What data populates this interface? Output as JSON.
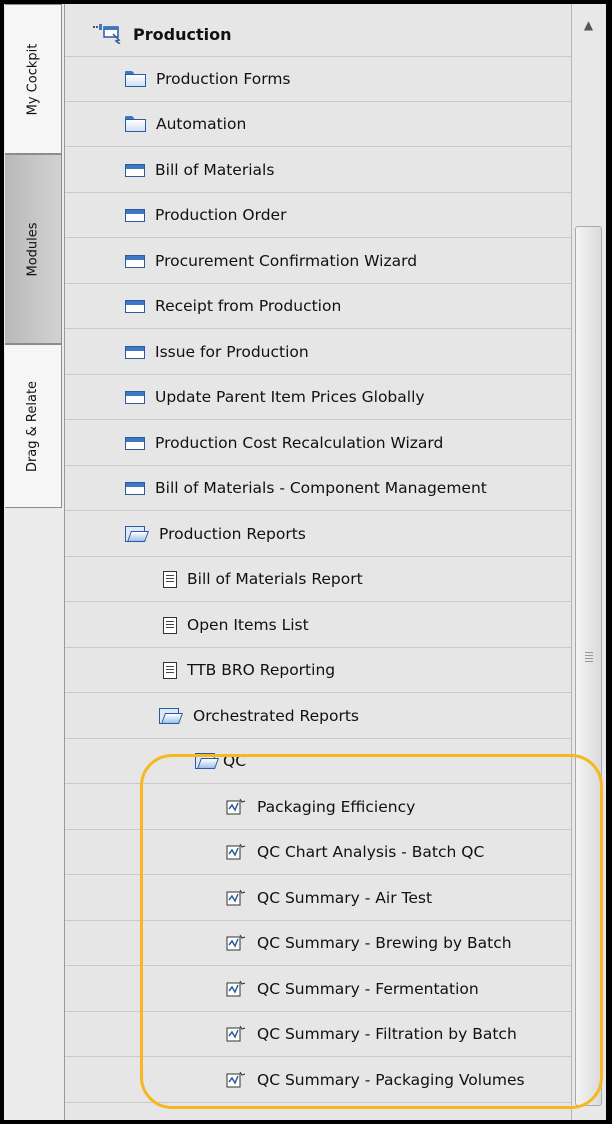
{
  "tabs": [
    {
      "label": "My Cockpit"
    },
    {
      "label": "Modules"
    },
    {
      "label": "Drag & Relate"
    }
  ],
  "tree": {
    "root": "Production",
    "items": [
      {
        "label": "Production Forms",
        "icon": "folder-icon"
      },
      {
        "label": "Automation",
        "icon": "folder-icon"
      },
      {
        "label": "Bill of Materials",
        "icon": "window-icon"
      },
      {
        "label": "Production Order",
        "icon": "window-icon"
      },
      {
        "label": "Procurement Confirmation Wizard",
        "icon": "window-icon"
      },
      {
        "label": "Receipt from Production",
        "icon": "window-icon"
      },
      {
        "label": "Issue for Production",
        "icon": "window-icon"
      },
      {
        "label": "Update Parent Item Prices Globally",
        "icon": "window-icon"
      },
      {
        "label": "Production Cost Recalculation Wizard",
        "icon": "window-icon"
      },
      {
        "label": "Bill of Materials - Component Management",
        "icon": "window-icon"
      },
      {
        "label": "Production Reports",
        "icon": "folder-open-icon"
      },
      {
        "label": "Bill of Materials Report",
        "icon": "report-icon"
      },
      {
        "label": "Open Items List",
        "icon": "report-icon"
      },
      {
        "label": "TTB BRO Reporting",
        "icon": "report-icon"
      },
      {
        "label": "Orchestrated Reports",
        "icon": "folder-open-icon"
      },
      {
        "label": "QC",
        "icon": "folder-open-icon"
      },
      {
        "label": "Packaging Efficiency",
        "icon": "orchestrated-report-icon"
      },
      {
        "label": "QC Chart Analysis - Batch QC",
        "icon": "orchestrated-report-icon"
      },
      {
        "label": "QC Summary - Air Test",
        "icon": "orchestrated-report-icon"
      },
      {
        "label": "QC Summary - Brewing by Batch",
        "icon": "orchestrated-report-icon"
      },
      {
        "label": "QC Summary - Fermentation",
        "icon": "orchestrated-report-icon"
      },
      {
        "label": "QC Summary - Filtration by Batch",
        "icon": "orchestrated-report-icon"
      },
      {
        "label": "QC Summary - Packaging Volumes",
        "icon": "orchestrated-report-icon"
      }
    ]
  },
  "colors": {
    "highlight": "#f5b820",
    "icon_blue": "#3b78c6"
  }
}
